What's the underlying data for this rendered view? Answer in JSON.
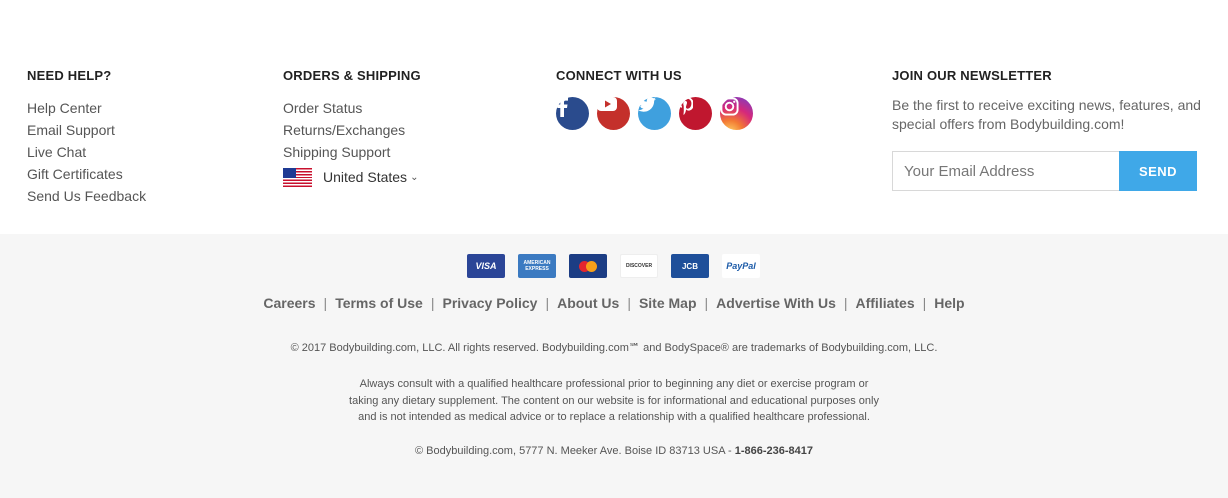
{
  "help": {
    "heading": "NEED HELP?",
    "links": [
      "Help Center",
      "Email Support",
      "Live Chat",
      "Gift Certificates",
      "Send Us Feedback"
    ]
  },
  "orders": {
    "heading": "ORDERS & SHIPPING",
    "links": [
      "Order Status",
      "Returns/Exchanges",
      "Shipping Support"
    ],
    "country": "United States"
  },
  "connect": {
    "heading": "CONNECT WITH US",
    "icons": [
      "facebook-icon",
      "youtube-icon",
      "twitter-icon",
      "pinterest-icon",
      "instagram-icon"
    ]
  },
  "newsletter": {
    "heading": "JOIN OUR NEWSLETTER",
    "text": "Be the first to receive exciting news, features, and special offers from Bodybuilding.com!",
    "placeholder": "Your Email Address",
    "button": "SEND"
  },
  "payment": {
    "visa": "VISA",
    "amex": "AMERICAN EXPRESS",
    "discover": "DISCOVER",
    "jcb": "JCB",
    "paypal": "PayPal"
  },
  "footer_links": [
    "Careers",
    "Terms of Use",
    "Privacy Policy",
    "About Us",
    "Site Map",
    "Advertise With Us",
    "Affiliates",
    "Help"
  ],
  "copyright": "© 2017 Bodybuilding.com, LLC. All rights reserved. Bodybuilding.com℠ and BodySpace® are trademarks of Bodybuilding.com, LLC.",
  "disclaimer": {
    "line1": "Always consult with a qualified healthcare professional prior to beginning any diet or exercise program or",
    "line2": "taking any dietary supplement. The content on our website is for informational and educational purposes only",
    "line3": "and is not intended as medical advice or to replace a relationship with a qualified healthcare professional."
  },
  "address": {
    "text": "©  Bodybuilding.com, 5777 N. Meeker Ave.  Boise ID  83713  USA - ",
    "phone": "1-866-236-8417"
  },
  "colors": {
    "send_button": "#3fa8e8",
    "bottom_background": "#f6f6f6"
  }
}
